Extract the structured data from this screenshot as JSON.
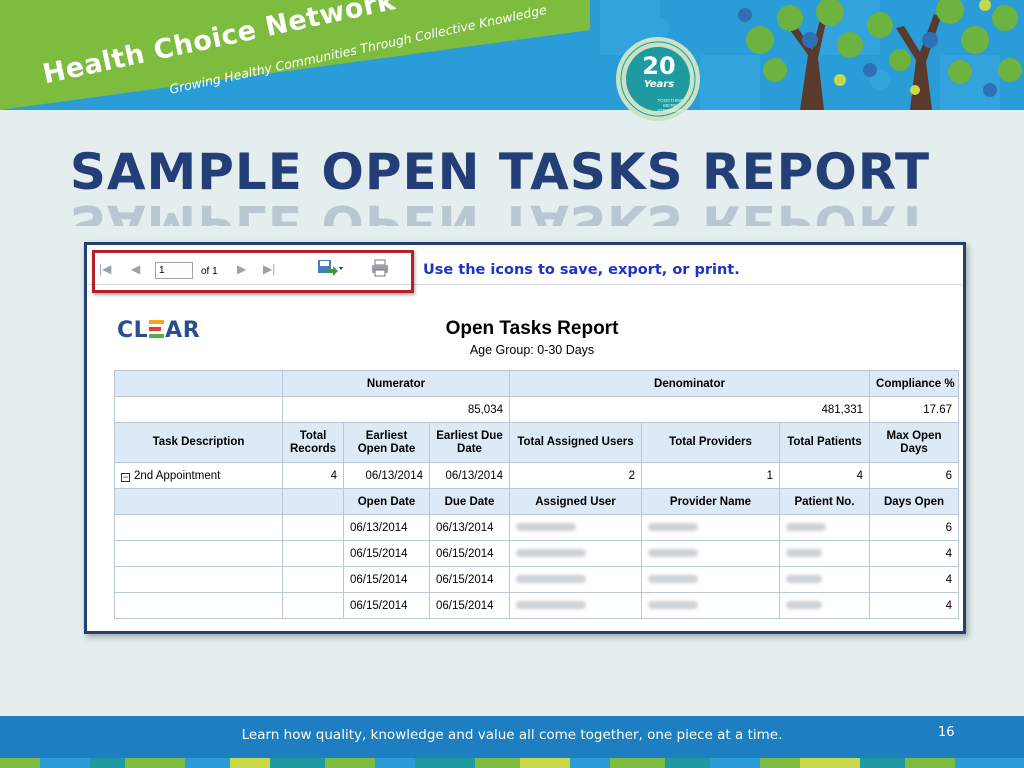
{
  "header": {
    "brand": "Health Choice Network",
    "tagline": "Growing Healthy Communities Through Collective Knowledge",
    "badge": {
      "number": "20",
      "word": "Years",
      "ring_text": "GROWING HEALTHY COMMUNITIES",
      "small_text": "TOGETHER WE'RE STRONGER"
    }
  },
  "slide": {
    "title": "SAMPLE OPEN TASKS REPORT",
    "page_number": "16",
    "footer": "Learn how quality, knowledge and value all come together, one piece at a time."
  },
  "toolbar": {
    "page_value": "1",
    "page_of": "of 1",
    "note": "Use the icons to save, export, or print."
  },
  "report": {
    "logo": "CL AR",
    "title": "Open Tasks Report",
    "subtitle": "Age Group: 0-30 Days",
    "groups": [
      "Numerator",
      "Denominator",
      "Compliance %"
    ],
    "totals": {
      "numerator": "85,034",
      "denominator": "481,331",
      "compliance": "17.67"
    },
    "columns": [
      "Task Description",
      "Total Records",
      "Earliest Open Date",
      "Earliest Due Date",
      "Total Assigned Users",
      "Total Providers",
      "Total Patients",
      "Max Open Days"
    ],
    "summary": {
      "task": "2nd Appointment",
      "total_records": "4",
      "earliest_open": "06/13/2014",
      "earliest_due": "06/13/2014",
      "assigned_users": "2",
      "providers": "1",
      "patients": "4",
      "max_open_days": "6"
    },
    "detail_columns": [
      "Open Date",
      "Due Date",
      "Assigned User",
      "Provider Name",
      "Patient No.",
      "Days Open"
    ],
    "detail_rows": [
      {
        "open": "06/13/2014",
        "due": "06/13/2014",
        "days": "6"
      },
      {
        "open": "06/15/2014",
        "due": "06/15/2014",
        "days": "4"
      },
      {
        "open": "06/15/2014",
        "due": "06/15/2014",
        "days": "4"
      },
      {
        "open": "06/15/2014",
        "due": "06/15/2014",
        "days": "4"
      }
    ]
  },
  "colors": {
    "title": "#243f78",
    "green": "#7ebc3f",
    "blue": "#2a9cd8",
    "highlight": "#b6202a",
    "note": "#1f31c9",
    "table_header": "#dce9f6"
  }
}
